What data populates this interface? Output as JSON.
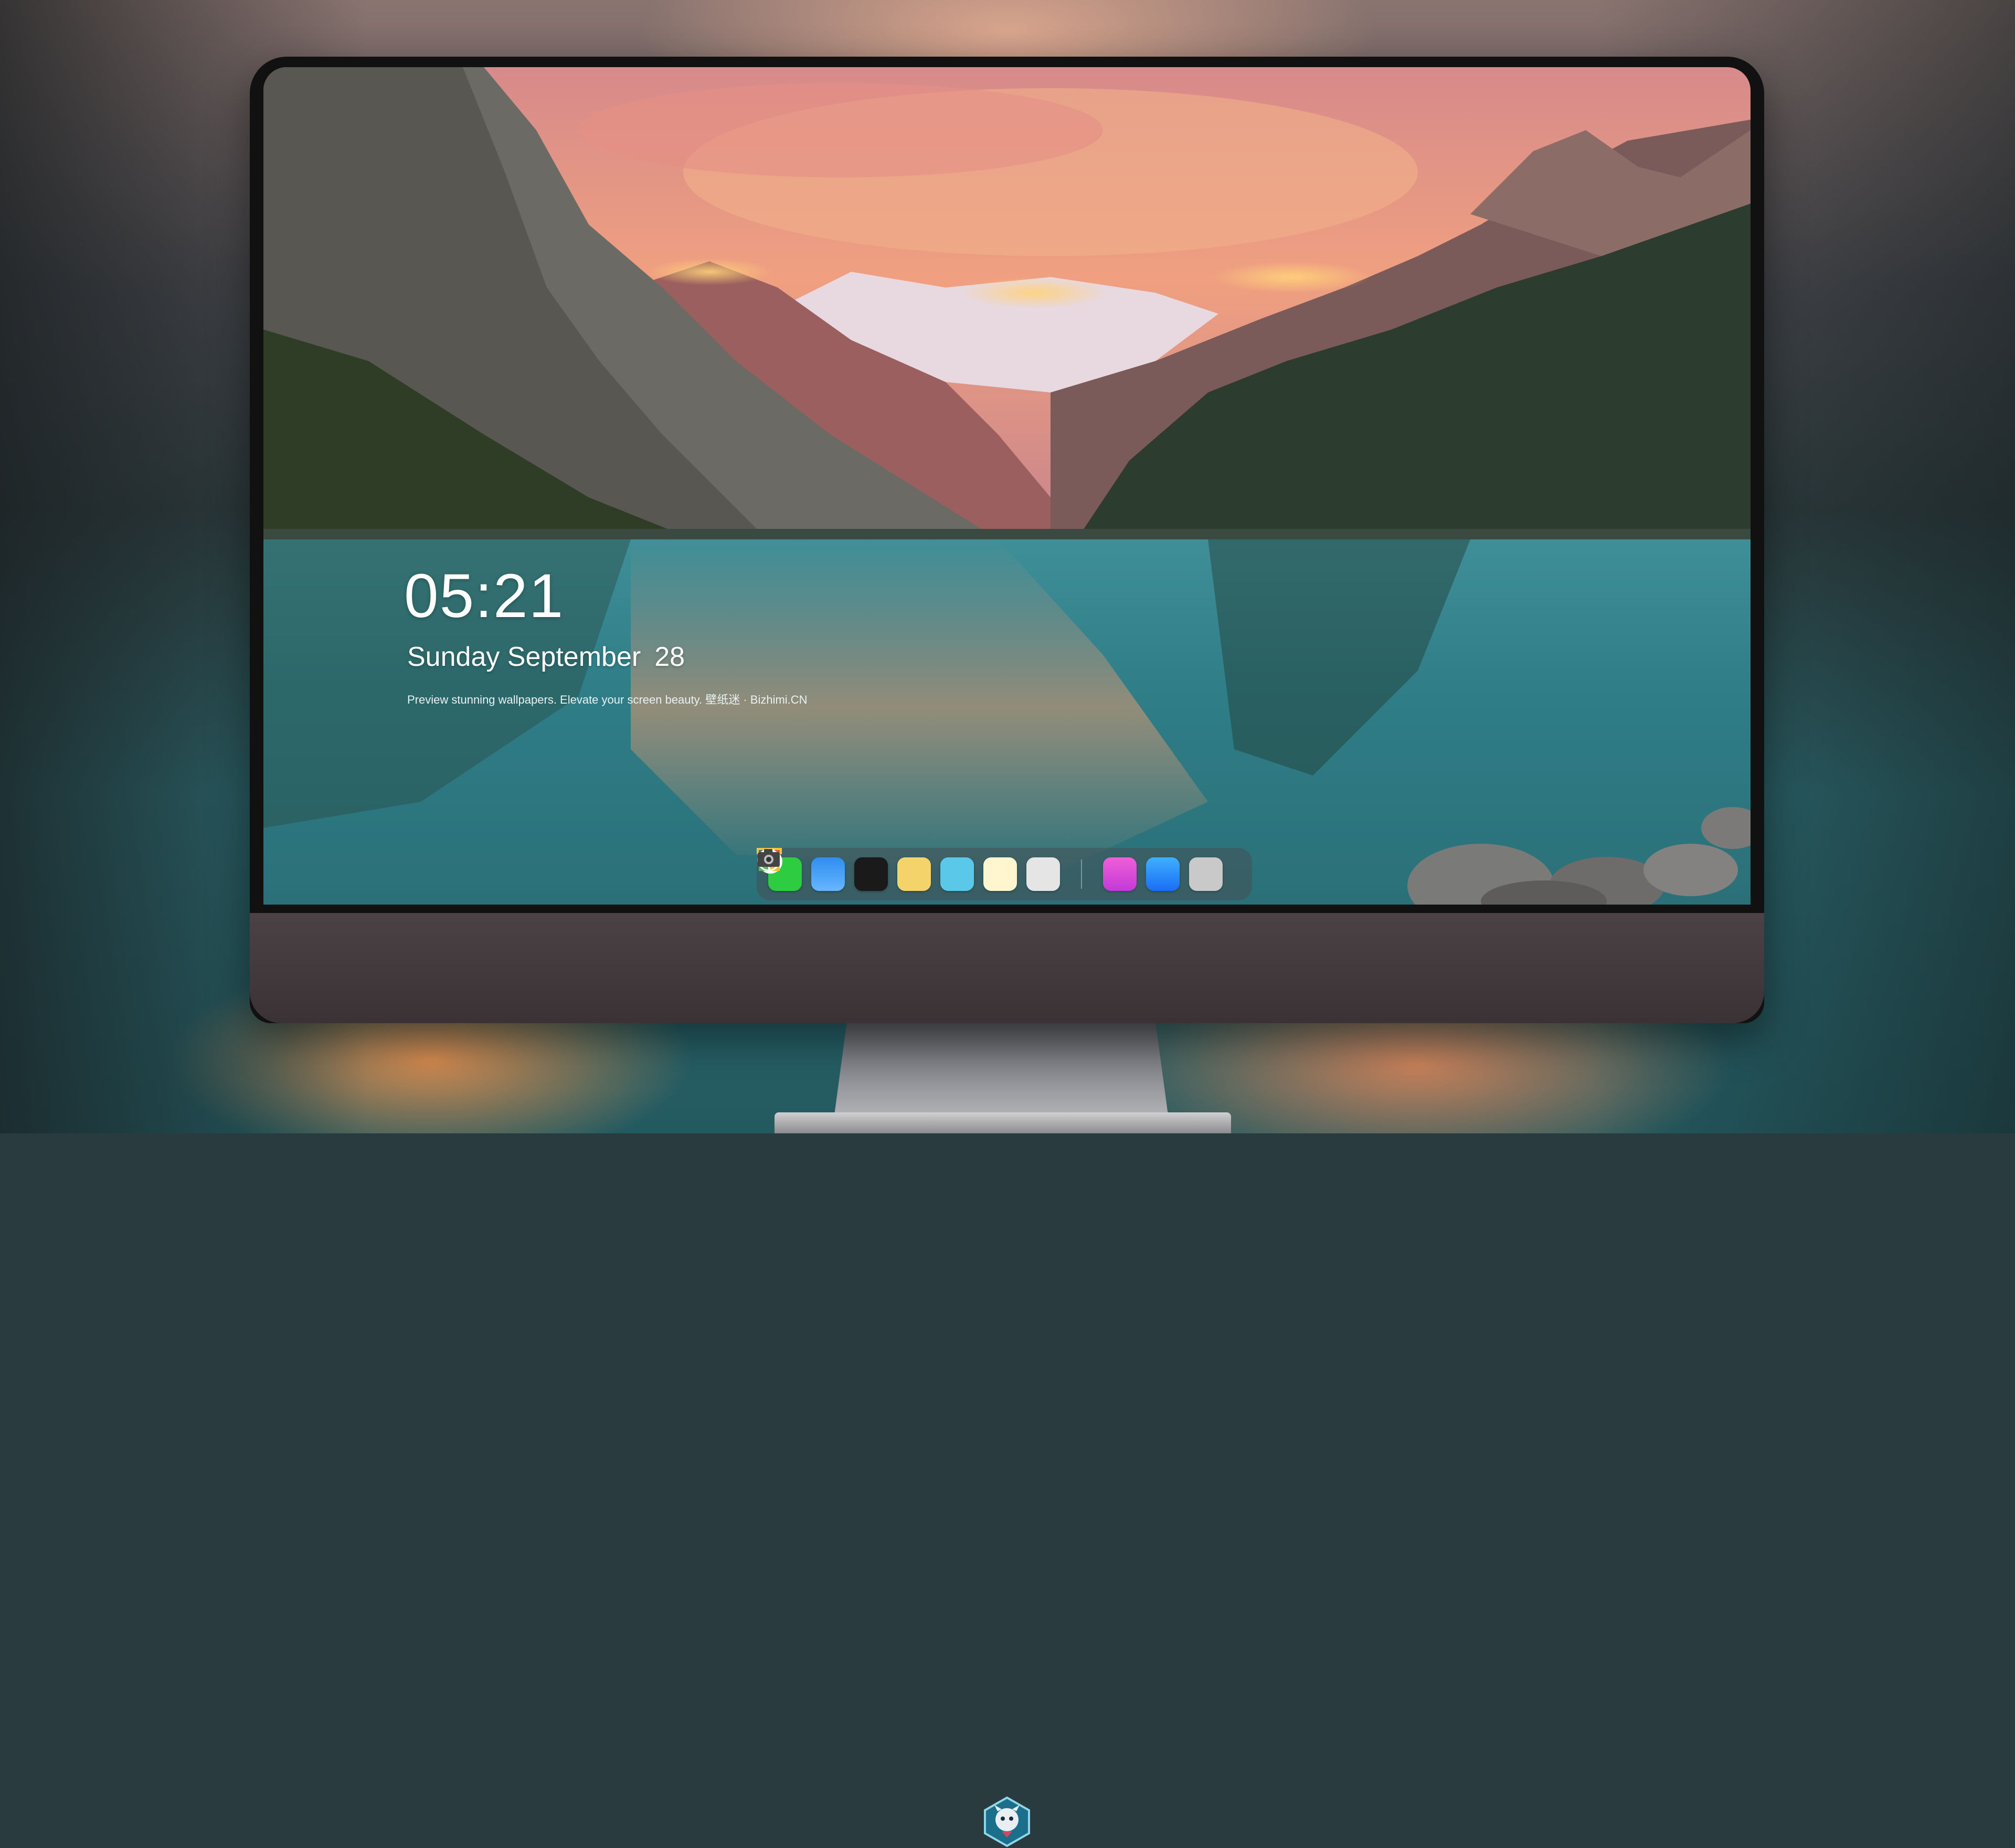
{
  "lock_screen": {
    "time": "05:21",
    "weekday_month": "Sunday September",
    "day": "28",
    "caption": "Preview stunning wallpapers. Elevate your screen beauty. 壁纸迷 · Bizhimi.CN"
  },
  "dock": {
    "apps": [
      {
        "name": "messages-icon",
        "color": "#2ecc40"
      },
      {
        "name": "weather-icon",
        "color": "#2f8df0"
      },
      {
        "name": "clock-icon",
        "color": "#1a1a1a"
      },
      {
        "name": "preview-icon",
        "color": "#f4d36a"
      },
      {
        "name": "clips-icon",
        "color": "#5ac8e8"
      },
      {
        "name": "notes-icon",
        "color": "#fff4c2"
      },
      {
        "name": "photo-booth-icon",
        "color": "#3e6f9e"
      },
      {
        "name": "music-icon",
        "color": "#e040c8"
      },
      {
        "name": "app-store-icon",
        "color": "#1a8cf5"
      },
      {
        "name": "camera-icon",
        "color": "#555555"
      }
    ]
  },
  "monitor": {
    "logo": "mascot-logo-icon"
  }
}
